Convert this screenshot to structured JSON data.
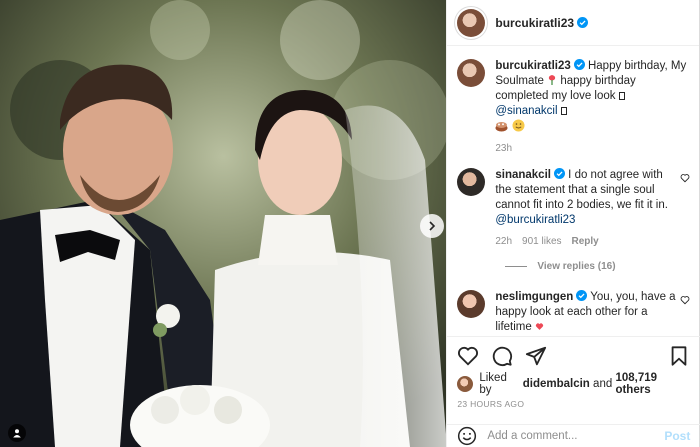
{
  "post": {
    "author": "burcukiratli23",
    "caption": {
      "username": "burcukiratli23",
      "text_part1": " Happy birthday, My Soulmate",
      "text_part2": " happy birthday completed my love look ",
      "mention": "@sinanakcil",
      "time": "23h"
    },
    "comments": [
      {
        "username": "sinanakcil",
        "text": " I do not agree with the statement that a single soul cannot fit into 2 bodies, we fit it in. ",
        "mention": "@burcukiratli23",
        "time": "22h",
        "likes": "901 likes",
        "reply_label": "Reply"
      },
      {
        "username": "neslimgungen",
        "text": " You, you, have a happy look at each other for a lifetime",
        "time": ""
      }
    ],
    "view_replies": "View replies (16)",
    "liked_by": {
      "prefix": "Liked by ",
      "user": "didembalcin",
      "middle": " and ",
      "count": "108,719 others"
    },
    "timestamp": "23 HOURS AGO",
    "add_comment_placeholder": "Add a comment...",
    "post_button": "Post"
  },
  "colors": {
    "verified": "#0095f6",
    "mention": "#00376b",
    "muted": "#8e8e8e",
    "post_button": "#b2dffc",
    "heart_red": "#ed4956"
  },
  "icons": [
    "heart-icon",
    "comment-icon",
    "share-icon",
    "bookmark-icon",
    "emoji-icon",
    "verified-icon",
    "chevron-right-icon",
    "user-tag-icon",
    "rose-emoji",
    "cake-emoji",
    "smile-emoji"
  ]
}
